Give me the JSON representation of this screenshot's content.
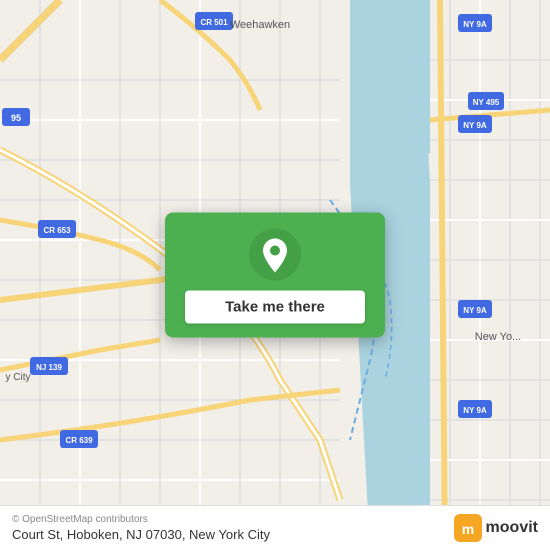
{
  "map": {
    "background_color": "#f2efe9",
    "water_color": "#aad3df",
    "road_color_major": "#f7d478",
    "road_color_minor": "#ffffff"
  },
  "card": {
    "background_color": "#4caf50",
    "button_label": "Take me there",
    "pin_icon": "location-pin"
  },
  "bottom_bar": {
    "copyright": "© OpenStreetMap contributors",
    "address": "Court St, Hoboken, NJ 07030, New York City",
    "logo_text": "moovit"
  }
}
